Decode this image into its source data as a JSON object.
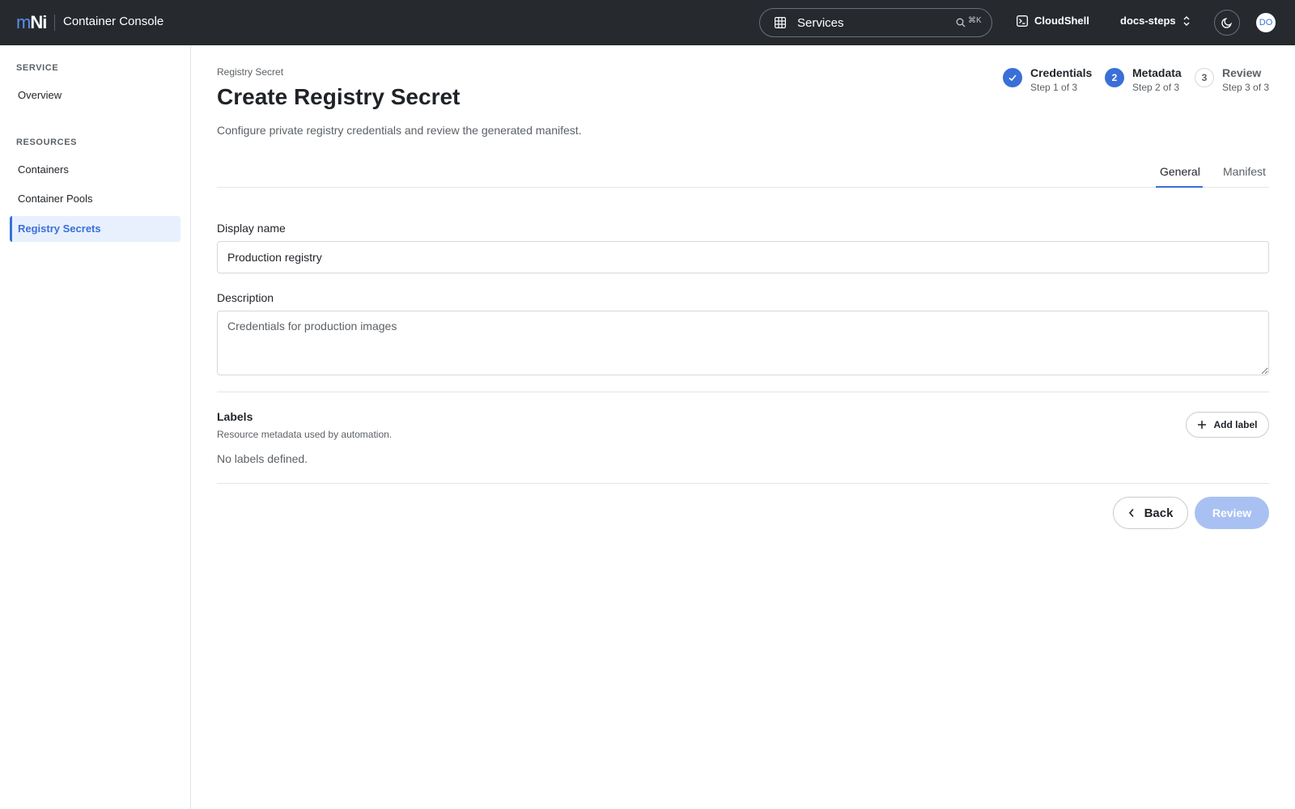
{
  "header": {
    "logo_m": "m",
    "logo_ni": "Ni",
    "app_title": "Container Console",
    "search_label": "Services",
    "search_shortcut": "⌘K",
    "cloudshell_label": "CloudShell",
    "project_label": "docs-steps",
    "avatar_initials": "DO",
    "icons": [
      "grid-icon",
      "search-icon",
      "terminal-icon",
      "chevron-up-down-icon",
      "moon-icon"
    ]
  },
  "sidebar": {
    "section_service": "SERVICE",
    "overview": "Overview",
    "section_resources": "RESOURCES",
    "items": [
      {
        "label": "Containers",
        "active": false
      },
      {
        "label": "Container Pools",
        "active": false
      },
      {
        "label": "Registry Secrets",
        "active": true
      }
    ]
  },
  "page": {
    "breadcrumb": "Registry Secret",
    "title": "Create Registry Secret",
    "description": "Configure private registry credentials and review the generated manifest."
  },
  "stepper": [
    {
      "number": "1",
      "name": "Credentials",
      "sub": "Step 1 of 3",
      "state": "done"
    },
    {
      "number": "2",
      "name": "Metadata",
      "sub": "Step 2 of 3",
      "state": "current"
    },
    {
      "number": "3",
      "name": "Review",
      "sub": "Step 3 of 3",
      "state": "todo"
    }
  ],
  "tabs": [
    {
      "label": "General",
      "active": true
    },
    {
      "label": "Manifest",
      "active": false
    }
  ],
  "form": {
    "display_name_label": "Display name",
    "display_name_value": "Production registry",
    "description_label": "Description",
    "description_placeholder": "Credentials for production images",
    "description_value": ""
  },
  "labels": {
    "title": "Labels",
    "subtitle": "Resource metadata used by automation.",
    "empty_text": "No labels defined.",
    "add_button": "Add label"
  },
  "footer": {
    "back_button": "Back",
    "review_button": "Review",
    "review_disabled": true
  },
  "colors": {
    "accent": "#3a6fd8",
    "topbar": "#262a2f",
    "accent_disabled": "#a9c1f2"
  }
}
